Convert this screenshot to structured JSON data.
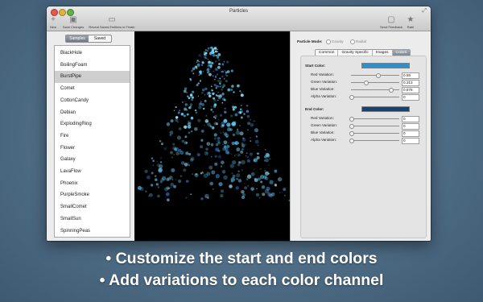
{
  "window": {
    "title": "Particles",
    "toolbar": [
      {
        "name": "new-button",
        "label": "New",
        "icon": "plus-icon"
      },
      {
        "name": "save-changes-button",
        "label": "Save Changes",
        "icon": "disk-icon"
      },
      {
        "name": "reveal-button",
        "label": "Reveal Saved Emitters in Finder",
        "icon": "folder-icon"
      },
      {
        "name": "send-feedback-button",
        "label": "Send Feedback",
        "icon": "speech-bubble-icon"
      },
      {
        "name": "rate-button",
        "label": "Rate",
        "icon": "star-icon"
      }
    ]
  },
  "sidebar": {
    "segments": [
      "Samples",
      "Saved"
    ],
    "selected_segment": "Samples",
    "items": [
      "BlackHole",
      "BoilingFoam",
      "BurstPipe",
      "Comet",
      "CottonCandy",
      "Debian",
      "ExplodingRing",
      "Fire",
      "Flower",
      "Galaxy",
      "LavaFlow",
      "Phoenix",
      "PurpleSmoke",
      "SmallComet",
      "SmallSun",
      "SpinningPeas"
    ],
    "selected_item": "BurstPipe"
  },
  "panel": {
    "mode_label": "Particle Mode:",
    "mode_options": [
      "Gravity",
      "Radial"
    ],
    "selected_mode": "Gravity",
    "tabs": [
      "Common",
      "Gravity Specific",
      "Images",
      "Colors"
    ],
    "active_tab": "Colors",
    "start": {
      "label": "Start Color:",
      "swatch_color": "#2f8fc8",
      "rows": [
        {
          "label": "Red Variation:",
          "value": "0.59",
          "level": 0.59
        },
        {
          "label": "Green Variation:",
          "value": "0.313",
          "level": 0.313
        },
        {
          "label": "Blue Variation:",
          "value": "0.878",
          "level": 0.878
        },
        {
          "label": "Alpha Variation:",
          "value": "0",
          "level": 0
        }
      ]
    },
    "end": {
      "label": "End Color:",
      "swatch_color": "#1d3f6e",
      "rows": [
        {
          "label": "Red Variation:",
          "value": "0",
          "level": 0
        },
        {
          "label": "Green Variation:",
          "value": "0",
          "level": 0
        },
        {
          "label": "Blue Variation:",
          "value": "0",
          "level": 0
        },
        {
          "label": "Alpha Variation:",
          "value": "0",
          "level": 0
        }
      ]
    }
  },
  "captions": [
    "• Customize the start and end colors",
    "• Add variations to each color channel"
  ]
}
